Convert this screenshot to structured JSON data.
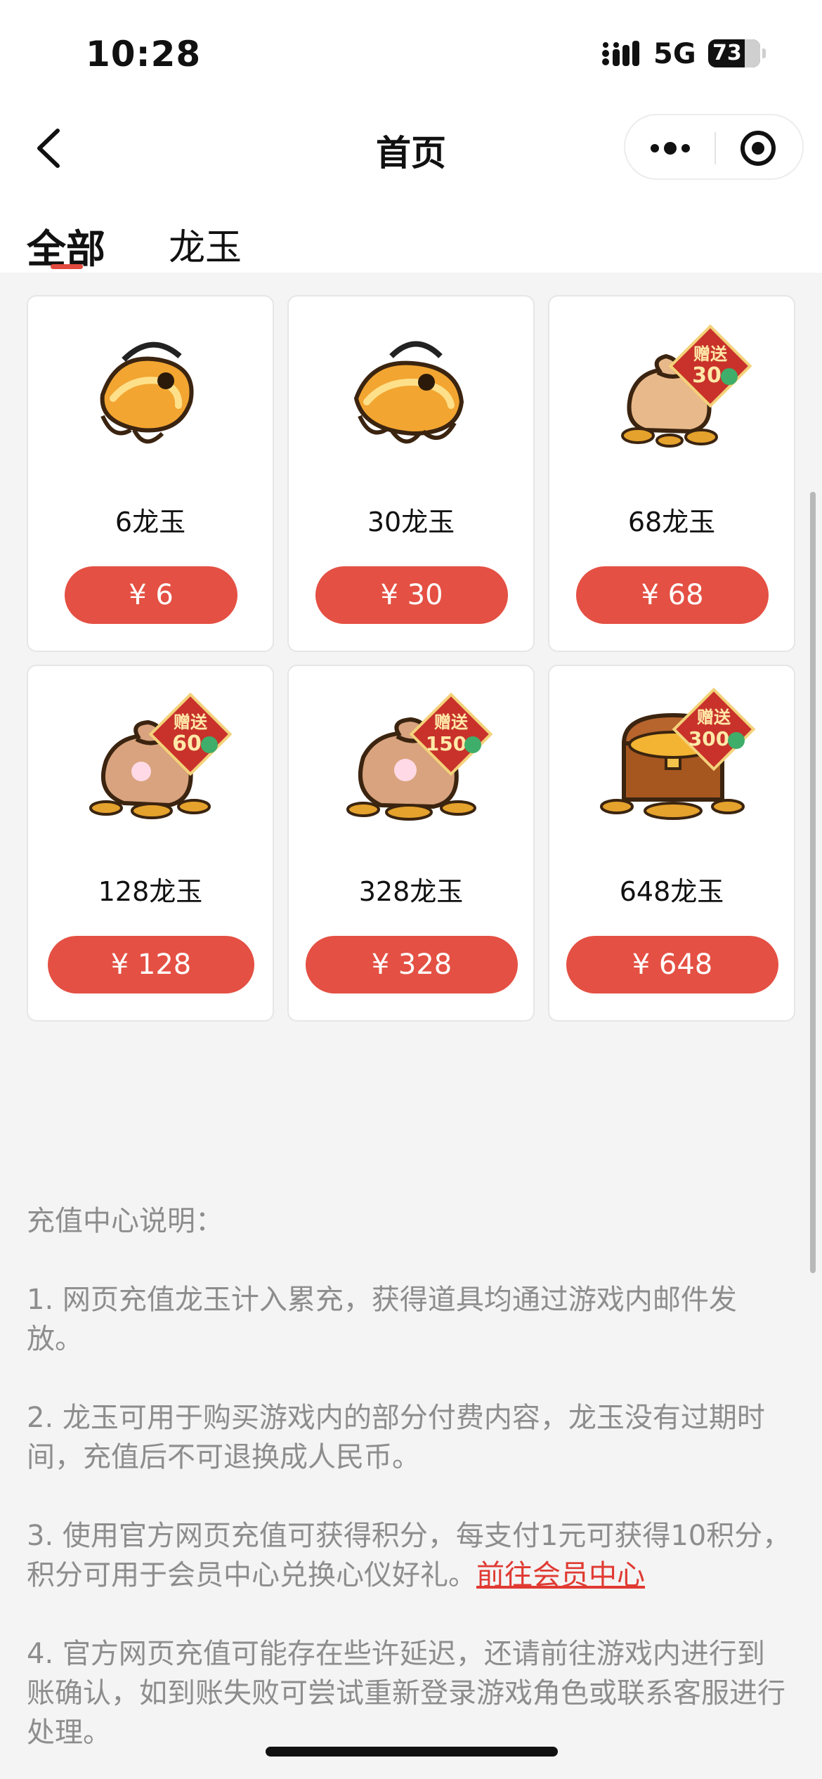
{
  "status_bar": {
    "time": "10:28",
    "network": "5G",
    "battery": "73"
  },
  "nav": {
    "title": "首页"
  },
  "tabs": [
    {
      "label": "全部",
      "active": true
    },
    {
      "label": "龙玉",
      "active": false
    }
  ],
  "products": [
    {
      "name": "6龙玉",
      "price": "¥ 6",
      "icon": "jade-pendant-icon"
    },
    {
      "name": "30龙玉",
      "price": "¥ 30",
      "icon": "jade-pendant-stack-icon"
    },
    {
      "name": "68龙玉",
      "price": "¥ 68",
      "icon": "coin-pouch-icon",
      "bonus_label": "赠送",
      "bonus_amount": "30"
    },
    {
      "name": "128龙玉",
      "price": "¥ 128",
      "icon": "coin-bag-icon",
      "bonus_label": "赠送",
      "bonus_amount": "60"
    },
    {
      "name": "328龙玉",
      "price": "¥ 328",
      "icon": "coin-bag-large-icon",
      "bonus_label": "赠送",
      "bonus_amount": "150"
    },
    {
      "name": "648龙玉",
      "price": "¥ 648",
      "icon": "treasure-chest-icon",
      "bonus_label": "赠送",
      "bonus_amount": "300"
    }
  ],
  "description": {
    "title": "充值中心说明：",
    "items": [
      "1. 网页充值龙玉计入累充，获得道具均通过游戏内邮件发放。",
      "2. 龙玉可用于购买游戏内的部分付费内容，龙玉没有过期时间，充值后不可退换成人民币。",
      "3. 使用官方网页充值可获得积分，每支付1元可获得10积分，积分可用于会员中心兑换心仪好礼。",
      "4. 官方网页充值可能存在些许延迟，还请前往游戏内进行到账确认，如到账失败可尝试重新登录游戏角色或联系客服进行处理。"
    ],
    "link_text": "前往会员中心"
  },
  "colors": {
    "accent": "#e45043",
    "link": "#e03a32",
    "bonus_badge": "#c8322b"
  }
}
